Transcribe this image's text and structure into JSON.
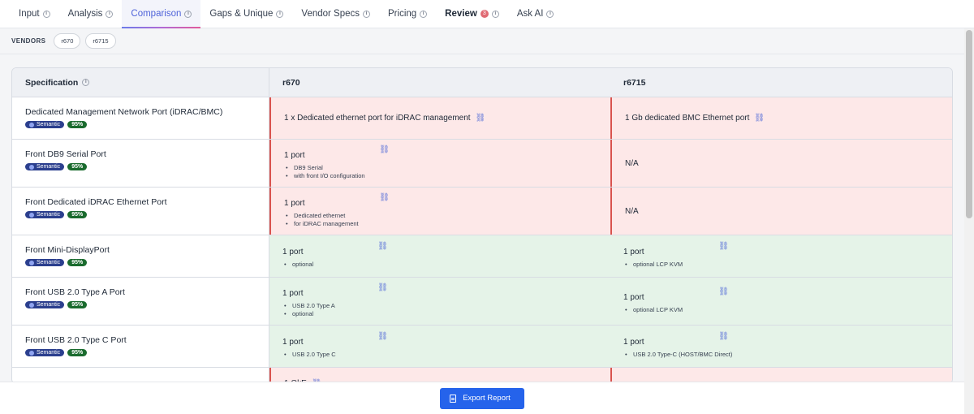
{
  "tabs": [
    {
      "label": "Input",
      "info": true,
      "active": false,
      "bold": false
    },
    {
      "label": "Analysis",
      "info": true,
      "active": false,
      "bold": false
    },
    {
      "label": "Comparison",
      "info": true,
      "active": true,
      "bold": false
    },
    {
      "label": "Gaps & Unique",
      "info": true,
      "active": false,
      "bold": false
    },
    {
      "label": "Vendor Specs",
      "info": true,
      "active": false,
      "bold": false
    },
    {
      "label": "Pricing",
      "info": true,
      "active": false,
      "bold": false
    },
    {
      "label": "Review",
      "info": true,
      "active": false,
      "bold": true,
      "badge": "3"
    },
    {
      "label": "Ask AI",
      "info": true,
      "active": false,
      "bold": false
    }
  ],
  "vendors": {
    "label": "VENDORS",
    "chips": [
      "r670",
      "r6715"
    ]
  },
  "table": {
    "header": {
      "spec": "Specification",
      "v1": "r670",
      "v2": "r6715"
    },
    "tag_semantic": "Semantic",
    "rows": [
      {
        "name": "Dedicated Management Network Port (iDRAC/BMC)",
        "pct": "95%",
        "status": "diff",
        "v1": {
          "value": "1 x Dedicated ethernet port for iDRAC management",
          "bullets": []
        },
        "v2": {
          "value": "1 Gb dedicated BMC Ethernet port",
          "bullets": []
        }
      },
      {
        "name": "Front DB9 Serial Port",
        "pct": "95%",
        "status": "diff",
        "v1": {
          "value": "1 port",
          "bullets": [
            "DB9 Serial",
            "with front I/O configuration"
          ]
        },
        "v2": {
          "value": "N/A",
          "bullets": []
        }
      },
      {
        "name": "Front Dedicated iDRAC Ethernet Port",
        "pct": "95%",
        "status": "diff",
        "v1": {
          "value": "1 port",
          "bullets": [
            "Dedicated ethernet",
            "for iDRAC management"
          ]
        },
        "v2": {
          "value": "N/A",
          "bullets": []
        }
      },
      {
        "name": "Front Mini-DisplayPort",
        "pct": "95%",
        "status": "same",
        "v1": {
          "value": "1 port",
          "bullets": [
            "optional"
          ]
        },
        "v2": {
          "value": "1 port",
          "bullets": [
            "optional LCP KVM"
          ]
        }
      },
      {
        "name": "Front USB 2.0 Type A Port",
        "pct": "95%",
        "status": "same",
        "v1": {
          "value": "1 port",
          "bullets": [
            "USB 2.0 Type A",
            "optional"
          ]
        },
        "v2": {
          "value": "1 port",
          "bullets": [
            "optional LCP KVM"
          ]
        }
      },
      {
        "name": "Front USB 2.0 Type C Port",
        "pct": "95%",
        "status": "same",
        "v1": {
          "value": "1 port",
          "bullets": [
            "USB 2.0 Type C"
          ]
        },
        "v2": {
          "value": "1 port",
          "bullets": [
            "USB 2.0 Type-C (HOST/BMC Direct)"
          ]
        }
      },
      {
        "name": "",
        "pct": "",
        "status": "diff",
        "v1": {
          "value": "1 OkE",
          "bullets": []
        },
        "v2": {
          "value": "",
          "bullets": []
        }
      }
    ]
  },
  "footer": {
    "export_label": "Export Report"
  },
  "colors": {
    "accent": "#4f63d9",
    "diff_bg": "#fde8e8",
    "same_bg": "#e5f3e8",
    "diff_border": "#d9534f",
    "button": "#2563eb"
  }
}
